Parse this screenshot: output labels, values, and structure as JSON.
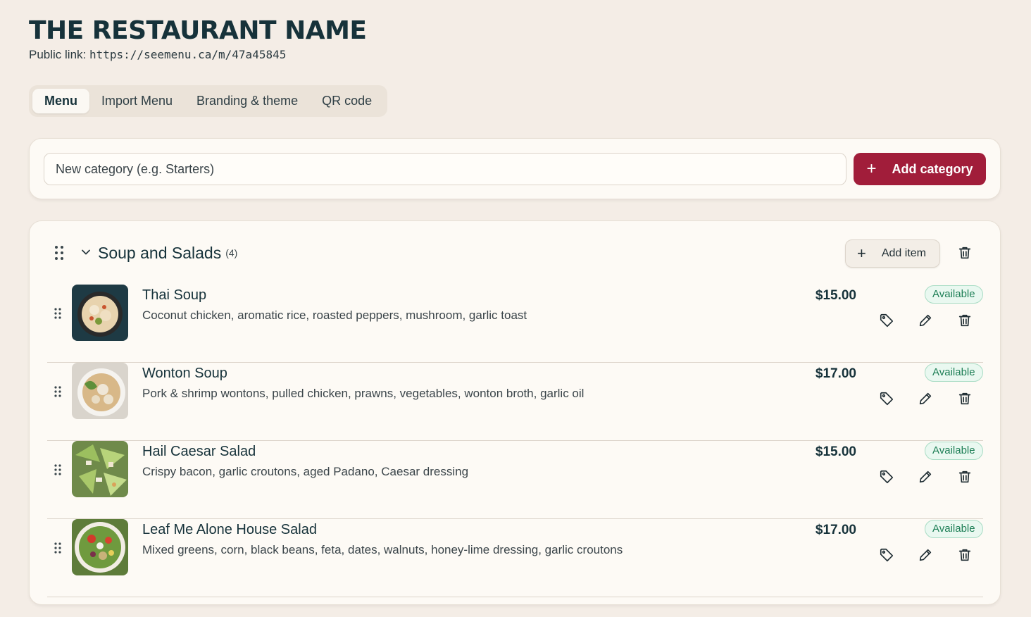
{
  "header": {
    "title": "THE RESTAURANT NAME",
    "public_link_label": "Public link:",
    "public_link_url": "https://seemenu.ca/m/47a45845"
  },
  "tabs": [
    {
      "label": "Menu",
      "active": true
    },
    {
      "label": "Import Menu",
      "active": false
    },
    {
      "label": "Branding & theme",
      "active": false
    },
    {
      "label": "QR code",
      "active": false
    }
  ],
  "add_category": {
    "placeholder": "New category (e.g. Starters)",
    "value": "",
    "button_label": "Add category"
  },
  "category": {
    "name": "Soup and Salads",
    "count": "(4)",
    "add_item_label": "Add item",
    "items": [
      {
        "name": "Thai Soup",
        "description": "Coconut chicken, aromatic rice, roasted peppers, mushroom, garlic toast",
        "price": "$15.00",
        "status": "Available"
      },
      {
        "name": "Wonton Soup",
        "description": "Pork & shrimp wontons, pulled chicken, prawns, vegetables, wonton broth, garlic oil",
        "price": "$17.00",
        "status": "Available"
      },
      {
        "name": "Hail Caesar Salad",
        "description": "Crispy bacon, garlic croutons, aged Padano, Caesar dressing",
        "price": "$15.00",
        "status": "Available"
      },
      {
        "name": "Leaf Me Alone House Salad",
        "description": "Mixed greens, corn, black beans, feta, dates, walnuts, honey-lime dressing, garlic croutons",
        "price": "$17.00",
        "status": "Available"
      }
    ]
  },
  "colors": {
    "background": "#f4ede6",
    "card": "#fdfaf5",
    "accent": "#a11d3a",
    "title": "#16323a",
    "available_text": "#1e7f56",
    "available_bg": "#e9f8f0"
  }
}
